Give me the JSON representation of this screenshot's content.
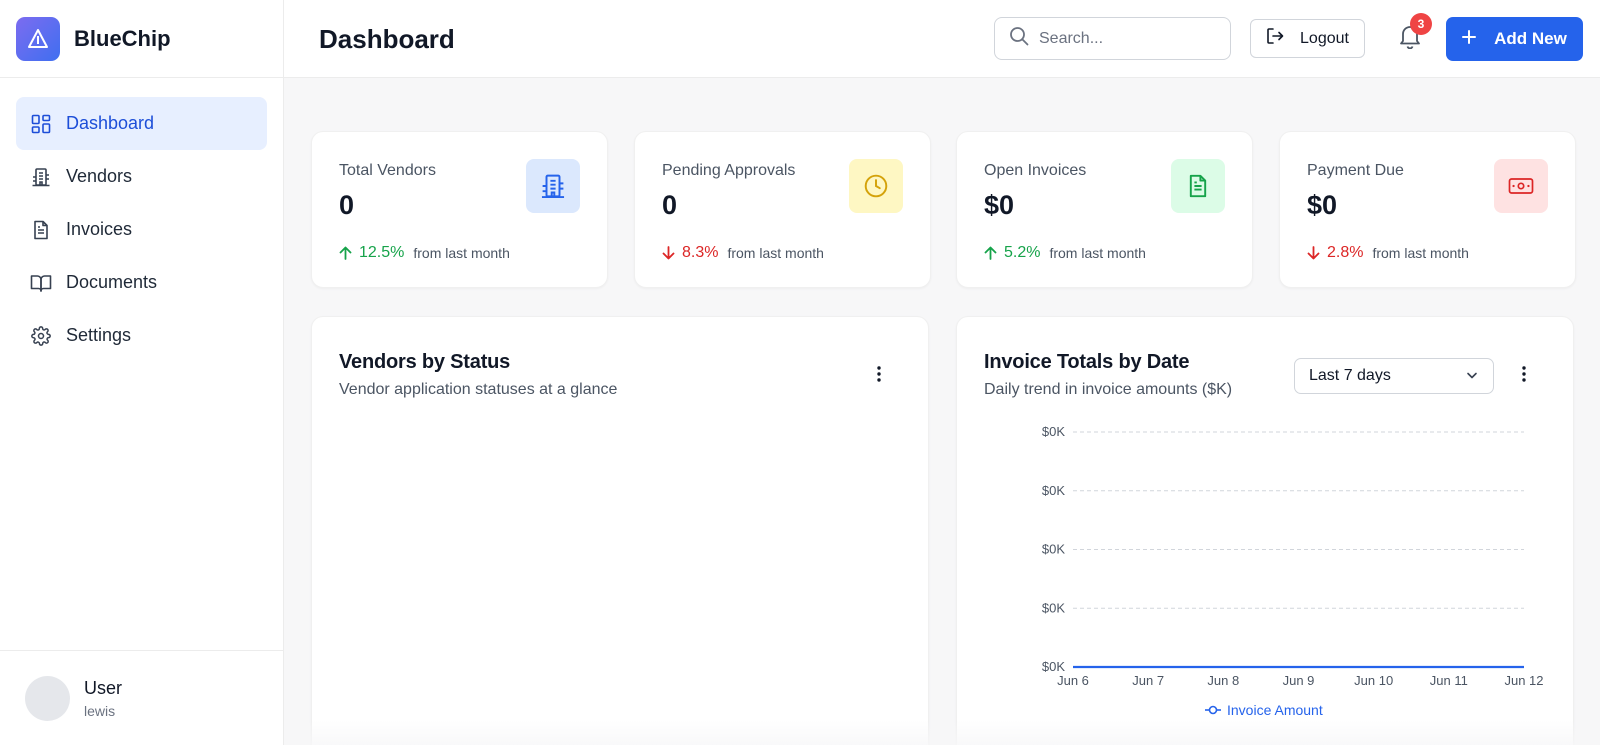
{
  "brand": {
    "name": "BlueChip"
  },
  "sidebar": {
    "items": [
      {
        "label": "Dashboard",
        "icon": "dashboard-grid-icon",
        "active": true
      },
      {
        "label": "Vendors",
        "icon": "building-icon",
        "active": false
      },
      {
        "label": "Invoices",
        "icon": "document-icon",
        "active": false
      },
      {
        "label": "Documents",
        "icon": "open-book-icon",
        "active": false
      },
      {
        "label": "Settings",
        "icon": "gear-icon",
        "active": false
      }
    ],
    "user": {
      "name": "User",
      "handle": "lewis"
    }
  },
  "header": {
    "title": "Dashboard",
    "search_placeholder": "Search...",
    "logout_label": "Logout",
    "notification_count": "3",
    "add_new_label": "Add New"
  },
  "colors": {
    "accent": "#2563eb",
    "up": "#16a34a",
    "down": "#dc2626"
  },
  "stats": [
    {
      "label": "Total Vendors",
      "value": "0",
      "change": "12.5%",
      "direction": "up",
      "suffix": "from last month",
      "icon": "building-icon",
      "icon_bg": "#dbe8fd",
      "icon_color": "#2563eb"
    },
    {
      "label": "Pending Approvals",
      "value": "0",
      "change": "8.3%",
      "direction": "down",
      "suffix": "from last month",
      "icon": "clock-icon",
      "icon_bg": "#fef7c3",
      "icon_color": "#d4a20a"
    },
    {
      "label": "Open Invoices",
      "value": "$0",
      "change": "5.2%",
      "direction": "up",
      "suffix": "from last month",
      "icon": "document-icon",
      "icon_bg": "#dcfce7",
      "icon_color": "#16a34a"
    },
    {
      "label": "Payment Due",
      "value": "$0",
      "change": "2.8%",
      "direction": "down",
      "suffix": "from last month",
      "icon": "banknote-icon",
      "icon_bg": "#fee2e2",
      "icon_color": "#dc2626"
    }
  ],
  "vendors_panel": {
    "title": "Vendors by Status",
    "subtitle": "Vendor application statuses at a glance"
  },
  "invoice_panel": {
    "title": "Invoice Totals by Date",
    "subtitle": "Daily trend in invoice amounts ($K)",
    "range_selected": "Last 7 days"
  },
  "chart_data": {
    "type": "line",
    "title": "Invoice Totals by Date",
    "categories": [
      "Jun 6",
      "Jun 7",
      "Jun 8",
      "Jun 9",
      "Jun 10",
      "Jun 11",
      "Jun 12"
    ],
    "y_tick_labels": [
      "$0K",
      "$0K",
      "$0K",
      "$0K",
      "$0K"
    ],
    "series": [
      {
        "name": "Invoice Amount",
        "values": [
          0,
          0,
          0,
          0,
          0,
          0,
          0
        ],
        "color": "#2563eb"
      }
    ],
    "ylim": [
      0,
      0
    ],
    "grid": true,
    "legend": "bottom"
  }
}
